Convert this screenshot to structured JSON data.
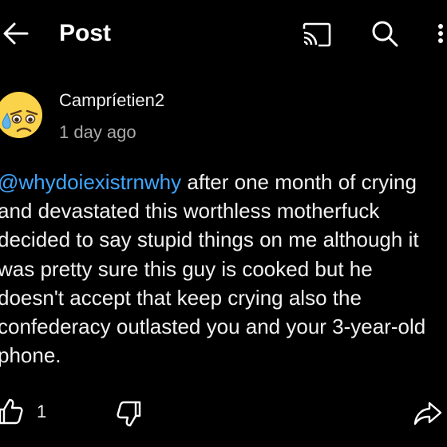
{
  "header": {
    "back_icon": "arrow-left-icon",
    "title": "Post",
    "cast_icon": "cast-icon",
    "search_icon": "search-icon",
    "more_icon": "more-vertical-icon"
  },
  "post": {
    "avatar_icon": "worried-sweat-face-emoji",
    "author": "Campríetien2",
    "time": "1 day ago",
    "mention": "@whydoiexistrnwhy",
    "lines": [
      " after one month of crying",
      "and devastated this worthless motherfuck",
      "decided to say stupid things on me although it",
      "was pretty sure this guy is cooked but he",
      "doesn't accept that keep crying also the",
      "confederacy outlasted you and your 3-year-old",
      "phone."
    ]
  },
  "actions": {
    "like_icon": "thumbs-up-icon",
    "like_count": "1",
    "dislike_icon": "thumbs-down-icon",
    "share_icon": "share-icon"
  },
  "colors": {
    "background": "#000000",
    "text": "#f1f1f1",
    "secondary_text": "#aaaaaa",
    "mention": "#3ea6ff"
  }
}
